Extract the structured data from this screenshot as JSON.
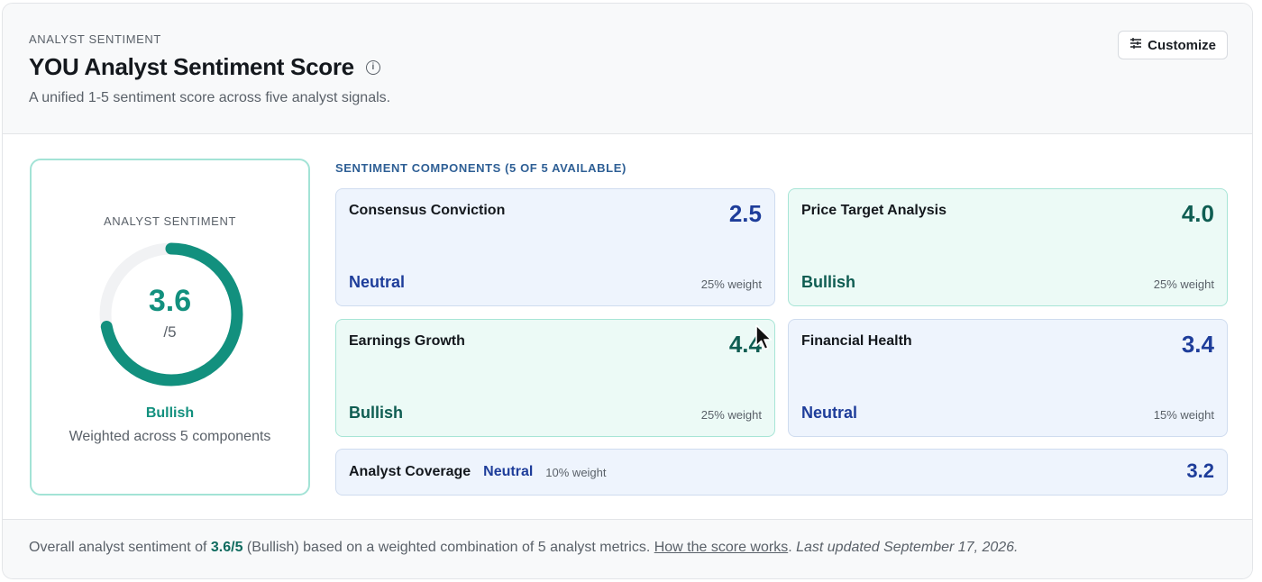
{
  "header": {
    "eyebrow": "ANALYST SENTIMENT",
    "title": "YOU Analyst Sentiment Score",
    "info_icon": "i",
    "subtitle": "A unified 1-5 sentiment score across five analyst signals.",
    "customize_label": "Customize"
  },
  "gauge": {
    "eyebrow": "ANALYST SENTIMENT",
    "value": "3.6",
    "max": "/5",
    "fraction": 0.72,
    "label": "Bullish",
    "sub": "Weighted across 5 components",
    "color": "#12907e",
    "track_color": "#f1f2f4"
  },
  "components": {
    "title": "SENTIMENT COMPONENTS (5 OF 5 AVAILABLE)",
    "items": [
      {
        "name": "Consensus Conviction",
        "score": "2.5",
        "label": "Neutral",
        "weight": "25% weight"
      },
      {
        "name": "Price Target Analysis",
        "score": "4.0",
        "label": "Bullish",
        "weight": "25% weight"
      },
      {
        "name": "Earnings Growth",
        "score": "4.4",
        "label": "Bullish",
        "weight": "25% weight"
      },
      {
        "name": "Financial Health",
        "score": "3.4",
        "label": "Neutral",
        "weight": "15% weight"
      }
    ],
    "coverage": {
      "name": "Analyst Coverage",
      "label": "Neutral",
      "weight": "10% weight",
      "score": "3.2"
    }
  },
  "footer": {
    "prefix": "Overall analyst sentiment of ",
    "score": "3.6/5",
    "middle": " (Bullish) based on a weighted combination of 5 analyst metrics. ",
    "link": "How the score works",
    "dot": ". ",
    "updated": "Last updated September 17, 2026."
  },
  "colors": {
    "bullish": "#0f5d52",
    "neutral": "#1e3d9a",
    "accent": "#12907e"
  }
}
